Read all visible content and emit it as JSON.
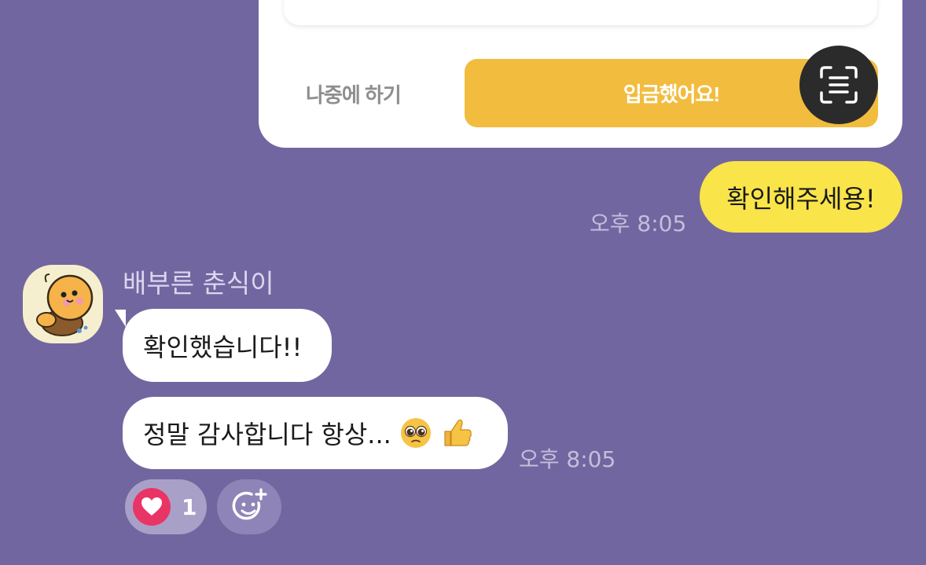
{
  "payment_card": {
    "later_label": "나중에 하기",
    "deposit_label": "입금했어요!"
  },
  "messages": {
    "mine": {
      "text": "확인해주세용!",
      "time": "오후 8:05"
    },
    "other": {
      "sender": "배부른 춘식이",
      "first_text": "확인했습니다!!",
      "second_text": "정말 감사합니다 항상...",
      "time": "오후 8:05"
    }
  },
  "reactions": {
    "heart_count": "1"
  },
  "icons": {
    "scan": "text-scan-icon",
    "heart": "heart-icon",
    "add_reaction": "add-emoji-icon",
    "pleading": "pleading-face-emoji",
    "thumbs_up": "thumbs-up-emoji"
  },
  "colors": {
    "background": "#7266a0",
    "my_bubble": "#f9e44a",
    "deposit_button": "#f2bc3e",
    "heart": "#e83566"
  }
}
